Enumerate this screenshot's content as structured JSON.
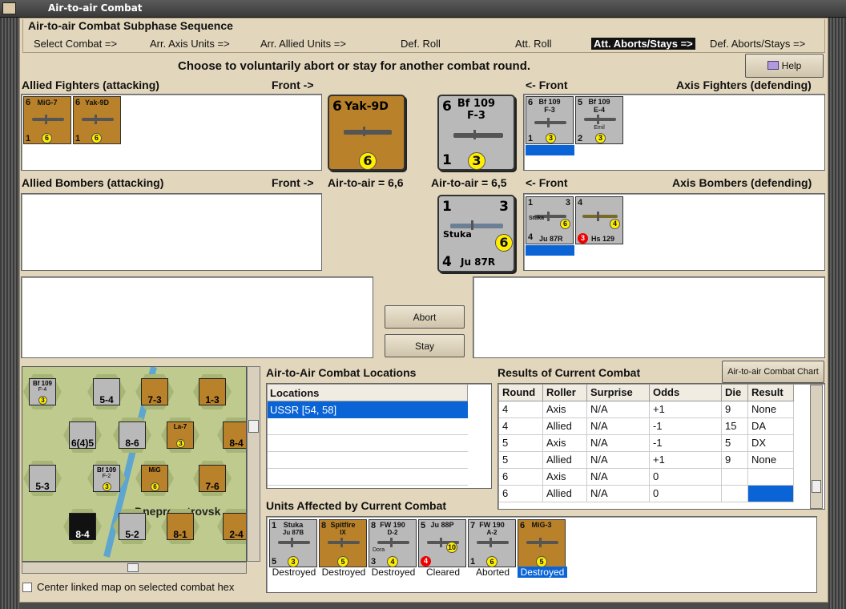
{
  "window": {
    "title": "Air-to-air Combat"
  },
  "sequence": {
    "title": "Air-to-air Combat Subphase Sequence",
    "steps": [
      "Select Combat =>",
      "Arr. Axis Units =>",
      "Arr. Allied Units =>",
      "Def. Roll",
      "Att. Roll",
      "Att. Aborts/Stays =>",
      "Def. Aborts/Stays =>"
    ],
    "active_index": 5
  },
  "instruction": "Choose to voluntarily abort or stay for another combat round.",
  "help_button": "Help",
  "allied_fighters": {
    "label": "Allied Fighters (attacking)",
    "front": "Front ->",
    "units": [
      {
        "name": "MiG-7",
        "atk": "6",
        "def": "1",
        "val": "6"
      },
      {
        "name": "Yak-9D",
        "atk": "6",
        "def": "1",
        "val": "6"
      }
    ]
  },
  "axis_fighters": {
    "label": "Axis Fighters (defending)",
    "front": "<- Front",
    "units": [
      {
        "name": "Bf 109",
        "sub": "F-3",
        "atk": "6",
        "def": "1",
        "val": "3"
      },
      {
        "name": "Bf 109",
        "sub": "E-4",
        "extra": "Emil",
        "atk": "5",
        "def": "2",
        "val": "3"
      }
    ]
  },
  "allied_bombers": {
    "label": "Allied Bombers (attacking)",
    "front": "Front ->"
  },
  "axis_bombers": {
    "label": "Axis Bombers (defending)",
    "front": "<- Front",
    "units": [
      {
        "name": "Stuka",
        "sub": "Ju 87R",
        "atk": "1",
        "def": "4",
        "top": "3",
        "val": "6"
      },
      {
        "name": "Hs 129",
        "atk": "4",
        "red": "3",
        "val": "4"
      }
    ]
  },
  "big_allied": {
    "name": "Yak-9D",
    "atk": "6",
    "val": "6",
    "odds_label": "Air-to-air = 6,6"
  },
  "big_axis_fighter": {
    "name": "Bf 109",
    "sub": "F-3",
    "atk": "6",
    "def": "1",
    "val": "3",
    "odds_label": "Air-to-air = 6,5"
  },
  "big_axis_bomber": {
    "name": "Stuka",
    "sub": "Ju 87R",
    "atk": "1",
    "top": "3",
    "def": "4",
    "val": "6"
  },
  "buttons": {
    "abort": "Abort",
    "stay": "Stay",
    "chart": "Air-to-air Combat Chart"
  },
  "map": {
    "checkbox_label": "Center linked map on selected combat hex",
    "place_label": "Dnepropetrovsk",
    "counters": [
      {
        "text": "Bf 109",
        "sub": "F-4",
        "val": "3",
        "color": "#b9b9b9"
      },
      {
        "text": "5-4",
        "color": "#b9b9b9"
      },
      {
        "text": "7-3",
        "color": "#b8812a"
      },
      {
        "text": "1-3",
        "color": "#b8812a"
      },
      {
        "text": "6(4)5",
        "color": "#b9b9b9"
      },
      {
        "text": "8-6",
        "color": "#b9b9b9"
      },
      {
        "text": "La-7",
        "val": "3",
        "color": "#b8812a"
      },
      {
        "text": "8-4",
        "color": "#b8812a"
      },
      {
        "text": "5-3",
        "color": "#b9b9b9"
      },
      {
        "text": "Bf 109",
        "sub": "F-2",
        "val": "3",
        "color": "#b9b9b9"
      },
      {
        "text": "MiG",
        "val": "6",
        "color": "#b8812a"
      },
      {
        "text": "7-6",
        "color": "#b8812a"
      },
      {
        "text": "8-4",
        "color": "#111111"
      },
      {
        "text": "5-2",
        "color": "#b9b9b9"
      },
      {
        "text": "8-1",
        "color": "#b8812a"
      },
      {
        "text": "2-4",
        "color": "#b8812a"
      }
    ]
  },
  "locations": {
    "title": "Air-to-Air Combat Locations",
    "header": "Locations",
    "items": [
      "USSR [54, 58]"
    ]
  },
  "results": {
    "title": "Results of Current Combat",
    "columns": [
      "Round",
      "Roller",
      "Surprise",
      "Odds",
      "Die",
      "Result"
    ],
    "rows": [
      [
        "4",
        "Axis",
        "N/A",
        "+1",
        "9",
        "None"
      ],
      [
        "4",
        "Allied",
        "N/A",
        "-1",
        "15",
        "DA"
      ],
      [
        "5",
        "Axis",
        "N/A",
        "-1",
        "5",
        "DX"
      ],
      [
        "5",
        "Allied",
        "N/A",
        "+1",
        "9",
        "None"
      ],
      [
        "6",
        "Axis",
        "N/A",
        "0",
        "",
        ""
      ],
      [
        "6",
        "Allied",
        "N/A",
        "0",
        "",
        ""
      ]
    ]
  },
  "affected": {
    "title": "Units Affected by Current Combat",
    "units": [
      {
        "name": "Stuka",
        "sub": "Ju 87B",
        "atk": "1",
        "def": "5",
        "val": "3",
        "status": "Destroyed",
        "color": "#b9b9b9"
      },
      {
        "name": "Spitfire",
        "sub": "IX",
        "atk": "8",
        "val": "5",
        "status": "Destroyed",
        "color": "#b8812a"
      },
      {
        "name": "FW 190",
        "sub": "D-2",
        "extra": "Dora",
        "atk": "8",
        "def": "3",
        "val": "4",
        "status": "Destroyed",
        "color": "#b9b9b9"
      },
      {
        "name": "Ju 88P",
        "atk": "5",
        "red": "4",
        "val": "10",
        "status": "Cleared",
        "color": "#b9b9b9"
      },
      {
        "name": "FW 190",
        "sub": "A-2",
        "atk": "7",
        "def": "1",
        "val": "6",
        "status": "Aborted",
        "color": "#b9b9b9"
      },
      {
        "name": "MiG-3",
        "atk": "6",
        "val": "5",
        "status": "Destroyed",
        "color": "#b8812a"
      }
    ]
  },
  "colors": {
    "panel": "#e2d6bc",
    "highlight": "#0a64d6",
    "brown": "#b8812a",
    "grey": "#b9b9b9",
    "yellow": "#ffee00"
  }
}
